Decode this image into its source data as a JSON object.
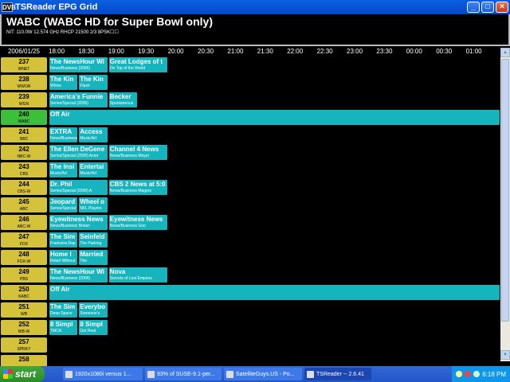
{
  "window": {
    "title": "TSReader EPG Grid",
    "app_icon": "DVB"
  },
  "header": {
    "channel_title": "WABC (WABC HD for Super Bowl only)",
    "channel_info": "NIT: 110.0W 12.574 GHz RHCP 21500 2/3 8PSK☐☐"
  },
  "timebar": {
    "date": "2006/01/25",
    "times": [
      "18:00",
      "18:30",
      "19:00",
      "19:30",
      "20:00",
      "20:30",
      "21:00",
      "21:30",
      "22:00",
      "22:30",
      "23:00",
      "23:30",
      "00:00",
      "00:30",
      "01:00"
    ]
  },
  "rows": [
    {
      "num": "237",
      "call": "WNET",
      "active": false,
      "programs": [
        {
          "title": "The NewsHour Wi",
          "desc": "News/Business  (2006)",
          "start": 0,
          "end": 2
        },
        {
          "title": "Great Lodges of t",
          "desc": "On Top of the World",
          "start": 2,
          "end": 4
        }
      ]
    },
    {
      "num": "238",
      "call": "WWOR",
      "active": false,
      "programs": [
        {
          "title": "The Kin",
          "desc": "Whine",
          "start": 0,
          "end": 1
        },
        {
          "title": "The Kin",
          "desc": "Flash",
          "start": 1,
          "end": 2
        }
      ]
    },
    {
      "num": "239",
      "call": "WGN",
      "active": false,
      "programs": [
        {
          "title": "America's Funnie",
          "desc": "Series/Special  (2005)",
          "start": 0,
          "end": 2
        },
        {
          "title": "Becker",
          "desc": "Spontaneous",
          "start": 2,
          "end": 3
        }
      ]
    },
    {
      "num": "240",
      "call": "WABC",
      "active": true,
      "programs": [
        {
          "title": "Off Air",
          "desc": "",
          "start": 0,
          "end": 15.5
        }
      ]
    },
    {
      "num": "241",
      "call": "NBC",
      "active": false,
      "programs": [
        {
          "title": "EXTRA",
          "desc": "News/Business",
          "start": 0,
          "end": 1
        },
        {
          "title": "Access",
          "desc": "Music/Art",
          "start": 1,
          "end": 2
        }
      ]
    },
    {
      "num": "242",
      "call": "NBC-W",
      "active": false,
      "programs": [
        {
          "title": "The Ellen DeGene",
          "desc": "Series/Special  (2006) Actor",
          "start": 0,
          "end": 2
        },
        {
          "title": "Channel 4 News",
          "desc": "News/Business  Moyer",
          "start": 2,
          "end": 4
        }
      ]
    },
    {
      "num": "243",
      "call": "CBS",
      "active": false,
      "programs": [
        {
          "title": "The Insi",
          "desc": "Music/Art",
          "start": 0,
          "end": 1
        },
        {
          "title": "Entertai",
          "desc": "Music/Art",
          "start": 1,
          "end": 2
        }
      ]
    },
    {
      "num": "244",
      "call": "CBS-W",
      "active": false,
      "programs": [
        {
          "title": "Dr. Phil",
          "desc": "Series/Special  (2006) A",
          "start": 0,
          "end": 2
        },
        {
          "title": "CBS 2 News at 5:0",
          "desc": "News/Business  Magers",
          "start": 2,
          "end": 4
        }
      ]
    },
    {
      "num": "245",
      "call": "ABC",
      "active": false,
      "programs": [
        {
          "title": "Jeopard",
          "desc": "Series/Special",
          "start": 0,
          "end": 1
        },
        {
          "title": "Wheel o",
          "desc": "NFL Players",
          "start": 1,
          "end": 2
        }
      ]
    },
    {
      "num": "246",
      "call": "ABC-W",
      "active": false,
      "programs": [
        {
          "title": "Eyewitness News",
          "desc": "News/Business  Brown",
          "start": 0,
          "end": 2
        },
        {
          "title": "Eyewitness News",
          "desc": "News/Business  Goo",
          "start": 2,
          "end": 4
        }
      ]
    },
    {
      "num": "247",
      "call": "FOX",
      "active": false,
      "programs": [
        {
          "title": "The Sim",
          "desc": "Frankstra Rap",
          "start": 0,
          "end": 1
        },
        {
          "title": "Seinfeld",
          "desc": "The Parking",
          "start": 1,
          "end": 2
        }
      ]
    },
    {
      "num": "248",
      "call": "FOX-W",
      "active": false,
      "programs": [
        {
          "title": "Home I",
          "desc": "Rebel Without",
          "start": 0,
          "end": 1
        },
        {
          "title": "Married",
          "desc": "The",
          "start": 1,
          "end": 2
        }
      ]
    },
    {
      "num": "249",
      "call": "PBS",
      "active": false,
      "programs": [
        {
          "title": "The NewsHour Wi",
          "desc": "News/Business  (2006)",
          "start": 0,
          "end": 2
        },
        {
          "title": "Nova",
          "desc": "Secrets of Lost Empires",
          "start": 2,
          "end": 4
        }
      ]
    },
    {
      "num": "250",
      "call": "KABC",
      "active": false,
      "programs": [
        {
          "title": "Off Air",
          "desc": "",
          "start": 0,
          "end": 15.5
        }
      ]
    },
    {
      "num": "251",
      "call": "WB",
      "active": false,
      "programs": [
        {
          "title": "The Sim",
          "desc": "Deep Space",
          "start": 0,
          "end": 1
        },
        {
          "title": "Everybo",
          "desc": "Someone's",
          "start": 1,
          "end": 2
        }
      ]
    },
    {
      "num": "252",
      "call": "WB-W",
      "active": false,
      "programs": [
        {
          "title": "8 Simpl",
          "desc": "TMCA",
          "start": 0,
          "end": 1
        },
        {
          "title": "8 Simpl",
          "desc": "Get Real",
          "start": 1,
          "end": 2
        }
      ]
    },
    {
      "num": "257",
      "call": "SPRKY",
      "active": false,
      "programs": []
    },
    {
      "num": "258",
      "call": "",
      "active": false,
      "programs": []
    }
  ],
  "taskbar": {
    "start_label": "start",
    "tasks": [
      {
        "label": "1920x1080i versus 1...",
        "active": false
      },
      {
        "label": "93% of SUSE-9.1-per...",
        "active": false
      },
      {
        "label": "SatelliteGuys.US - Po...",
        "active": false
      },
      {
        "label": "TSReader -- 2.6.41",
        "active": true
      }
    ],
    "clock": "6:18 PM"
  }
}
